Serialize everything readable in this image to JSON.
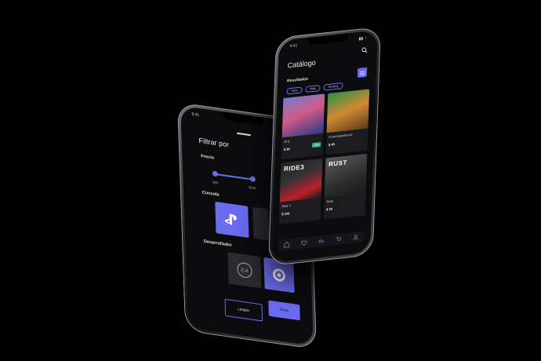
{
  "filter_screen": {
    "status_time": "9:41",
    "title": "Filtrar por",
    "price_section": "Precio",
    "price_min": "$20",
    "price_max": "$100",
    "console_section": "Consola",
    "consoles": [
      {
        "icon": "playstation-icon",
        "selected": true
      },
      {
        "icon": "console-icon",
        "selected": false
      }
    ],
    "developer_section": "Desarrollador",
    "developers": [
      {
        "icon": "ea-logo-icon",
        "selected": false
      },
      {
        "icon": "ubisoft-logo-icon",
        "selected": true
      }
    ],
    "clear_button": "Limpiar",
    "filter_button": "Filtrar"
  },
  "catalog_screen": {
    "status_time": "9:41",
    "title": "Catálogo",
    "results_label": "Resultados",
    "chips": [
      "Xbox",
      "Ride",
      "Rocking"
    ],
    "games": [
      {
        "name": "Griz",
        "price": "$ 90",
        "badge": "-20%"
      },
      {
        "name": "Crash Bandicoot",
        "price": "$ 45"
      },
      {
        "name": "Ride 3",
        "price": "$ 100",
        "art_label": "RIDE3"
      },
      {
        "name": "Rust",
        "price": "$ 30",
        "art_label": "RUST"
      }
    ],
    "nav_icons": [
      "home-icon",
      "heart-icon",
      "games-icon",
      "cart-icon",
      "user-icon"
    ]
  },
  "colors": {
    "accent": "#6b6cf0",
    "background": "#000000",
    "card": "#1b1b20",
    "badge": "#3ab07a"
  }
}
